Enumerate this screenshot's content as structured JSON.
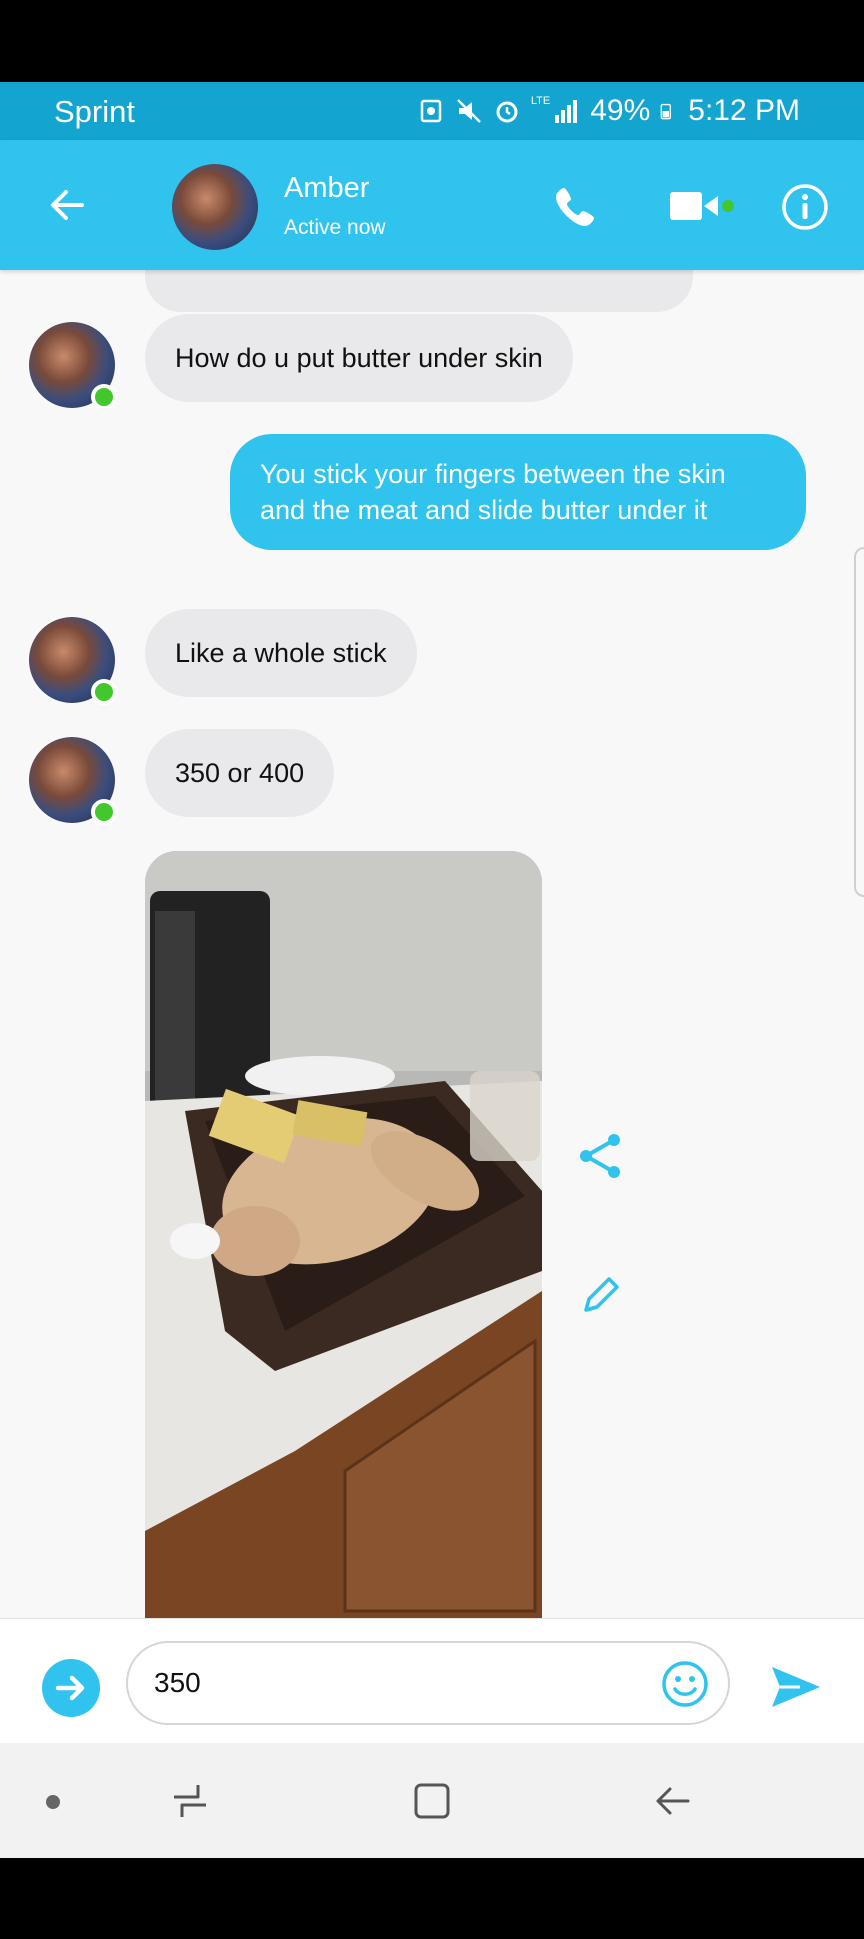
{
  "status_bar": {
    "carrier": "Sprint",
    "network": "LTE",
    "battery": "49%",
    "time": "5:12 PM"
  },
  "header": {
    "contact_name": "Amber",
    "contact_status": "Active now",
    "icons": [
      "back-arrow-icon",
      "phone-icon",
      "video-camera-icon",
      "info-icon"
    ]
  },
  "messages": [
    {
      "sender": "contact",
      "text": "How do u put butter under skin"
    },
    {
      "sender": "me",
      "text": "You stick your fingers between the skin and the meat and slide butter under it"
    },
    {
      "sender": "contact",
      "text": "Like a whole stick"
    },
    {
      "sender": "contact",
      "text": "350 or 400"
    },
    {
      "sender": "contact",
      "type": "photo"
    }
  ],
  "composer": {
    "value": "350"
  },
  "colors": {
    "status_bar": "#13a4cf",
    "header": "#2fc3ee",
    "incoming_bubble": "#e9e9eb",
    "outgoing_bubble": "#2fc3ee",
    "online": "#42c82d"
  }
}
